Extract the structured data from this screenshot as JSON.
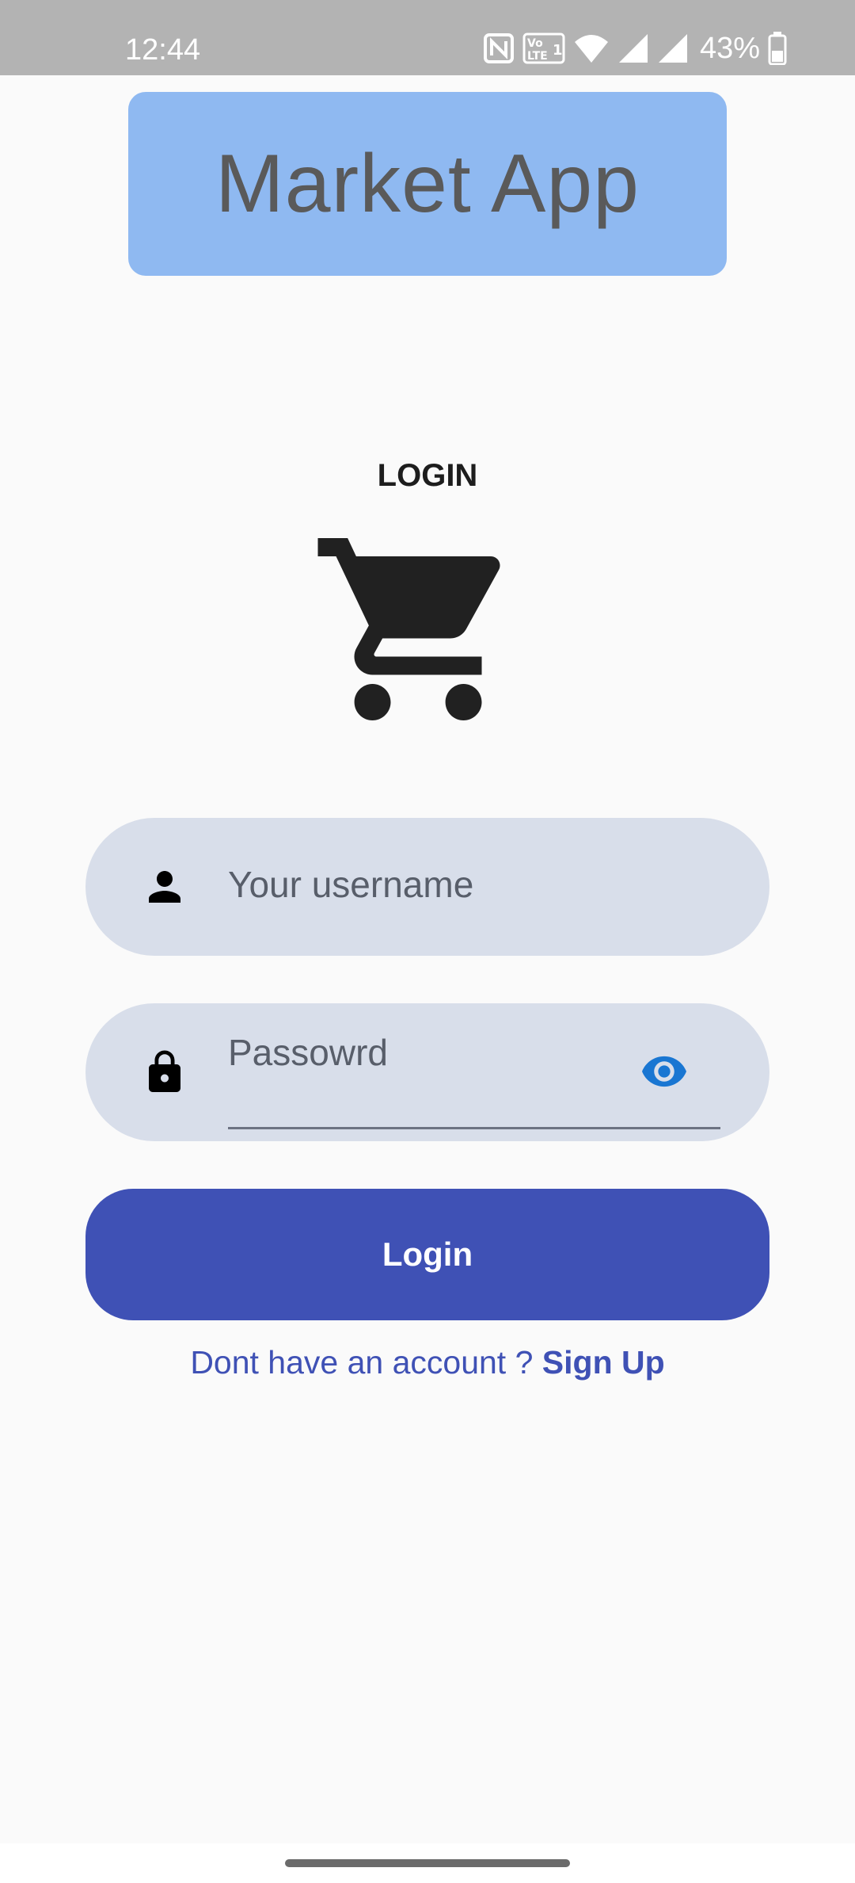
{
  "status_bar": {
    "time": "12:44",
    "battery": "43%",
    "icons": [
      "nfc-icon",
      "volte-icon",
      "wifi-icon",
      "signal-icon",
      "signal-icon",
      "battery-icon"
    ]
  },
  "header": {
    "title": "Market App",
    "background_color": "#8fb9f1"
  },
  "login": {
    "heading": "LOGIN",
    "icon": "shopping-cart-icon",
    "username": {
      "icon": "person-icon",
      "placeholder": "Your username",
      "value": ""
    },
    "password": {
      "icon": "lock-icon",
      "placeholder": "Passowrd",
      "value": "",
      "toggle_icon": "eye-icon"
    },
    "button_label": "Login",
    "signup_prompt": "Dont have an account ? ",
    "signup_link": "Sign Up",
    "accent_color": "#3f51b5"
  }
}
